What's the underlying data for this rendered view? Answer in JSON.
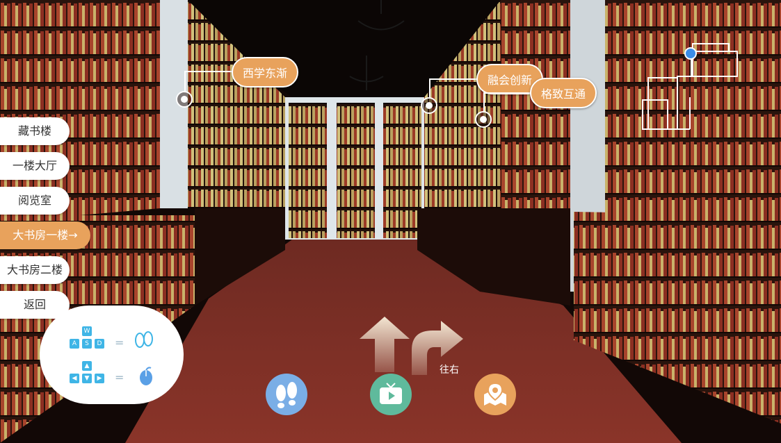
{
  "hotspots": [
    {
      "label": "西学东渐"
    },
    {
      "label": "融会创新"
    },
    {
      "label": "格致互通"
    }
  ],
  "nav": {
    "items": [
      {
        "label": "藏书楼"
      },
      {
        "label": "一楼大厅"
      },
      {
        "label": "阅览室"
      },
      {
        "label": "大书房一楼→",
        "active": true
      },
      {
        "label": "大书房二楼"
      },
      {
        "label": "返回"
      }
    ]
  },
  "keyhint": {
    "w": "W",
    "a": "A",
    "s": "S",
    "d": "D",
    "eq1": "=",
    "eq2": "=",
    "move_icon": "footprints-icon",
    "look_icon": "mouse-icon"
  },
  "arrows": {
    "right_label": "往右"
  },
  "toolbar": {
    "walk_icon": "footprints-icon",
    "video_icon": "tv-play-icon",
    "map_icon": "map-pin-icon"
  },
  "colors": {
    "accent": "#e8a25c",
    "walk": "#7aaee6",
    "video": "#5fba9c",
    "map": "#e8a25c",
    "minimap_dot": "#3b8de8"
  }
}
